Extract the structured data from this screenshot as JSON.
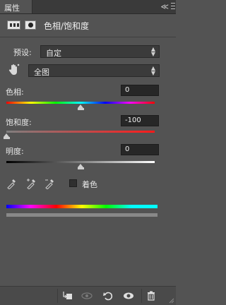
{
  "panel": {
    "tab_label": "属性",
    "close_glyph": "≪",
    "title": "色相/饱和度"
  },
  "preset": {
    "label": "预设:",
    "value": "自定"
  },
  "channel": {
    "value": "全图"
  },
  "hue": {
    "label": "色相:",
    "value": "0",
    "level": 0.5
  },
  "saturation": {
    "label": "饱和度:",
    "value": "-100",
    "level": 0.0
  },
  "lightness": {
    "label": "明度:",
    "value": "0",
    "level": 0.5
  },
  "colorize": {
    "label": "着色",
    "checked": false
  },
  "colors": {
    "panel_bg": "#535353",
    "field_bg": "#272727",
    "text": "#e8e8e8"
  },
  "icons": {
    "adjustment": "hue-saturation-layer-icon",
    "mask": "layer-mask-icon",
    "target_adjust": "hand-target-icon",
    "eyedroppers": [
      "eyedropper-icon",
      "eyedropper-add-icon",
      "eyedropper-subtract-icon"
    ],
    "bottom": [
      "clip-to-layer-icon",
      "view-previous-state-icon",
      "reset-icon",
      "visibility-eye-icon",
      "trash-icon"
    ]
  }
}
